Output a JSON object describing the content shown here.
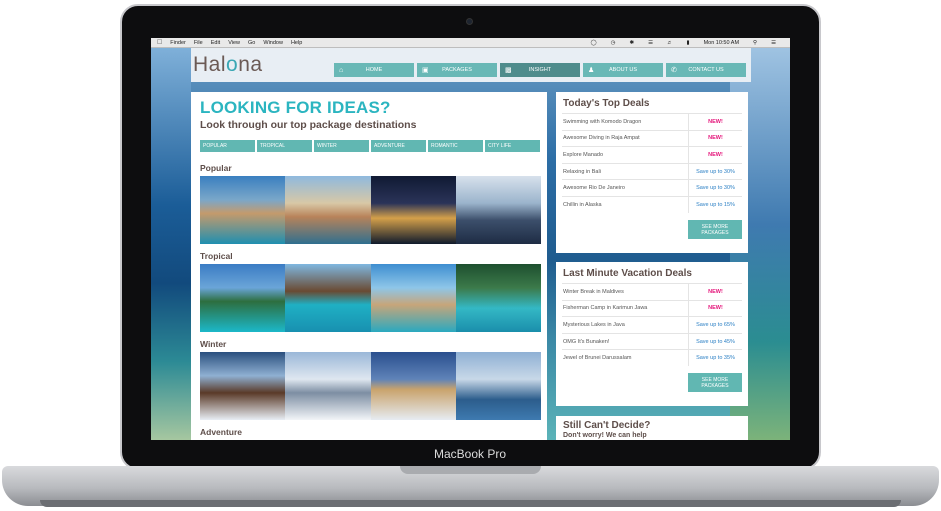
{
  "device": {
    "brand": "MacBook Pro"
  },
  "menubar": {
    "items": [
      "Finder",
      "File",
      "Edit",
      "View",
      "Go",
      "Window",
      "Help"
    ],
    "clock": "Mon 10:50 AM"
  },
  "site": {
    "logo_prefix": "Hal",
    "logo_o": "o",
    "logo_suffix": "na",
    "nav": [
      {
        "label": "HOME",
        "icon": "home-icon"
      },
      {
        "label": "PACKAGES",
        "icon": "gift-icon"
      },
      {
        "label": "INSIGHT",
        "icon": "camera-icon"
      },
      {
        "label": "ABOUT US",
        "icon": "user-icon"
      },
      {
        "label": "CONTACT US",
        "icon": "phone-icon"
      }
    ]
  },
  "main": {
    "heading": "LOOKING FOR IDEAS?",
    "subheading": "Look through our top package destinations",
    "tabs": [
      "POPULAR",
      "TROPICAL",
      "WINTER",
      "ADVENTURE",
      "ROMANTIC",
      "CITY LIFE"
    ],
    "sections": [
      "Popular",
      "Tropical",
      "Winter",
      "Adventure"
    ]
  },
  "top_deals": {
    "title": "Today's Top Deals",
    "rows": [
      {
        "name": "Swimming with Komodo Dragon",
        "tag": "NEW!"
      },
      {
        "name": "Awesome Diving in Raja Ampat",
        "tag": "NEW!"
      },
      {
        "name": "Explore Manado",
        "tag": "NEW!"
      },
      {
        "name": "Relaxing in Bali",
        "tag": "Save up to 30%"
      },
      {
        "name": "Awesome Rio De Janeiro",
        "tag": "Save up to 30%"
      },
      {
        "name": "Chillin in Alaska",
        "tag": "Save up to 15%"
      }
    ],
    "button": "SEE MORE PACKAGES"
  },
  "last_minute": {
    "title": "Last Minute Vacation Deals",
    "rows": [
      {
        "name": "Winter Break in Maldives",
        "tag": "NEW!"
      },
      {
        "name": "Fisherman Camp in Karimun Jawa",
        "tag": "NEW!"
      },
      {
        "name": "Mysterious Lakes in Java",
        "tag": "Save up to 65%"
      },
      {
        "name": "OMG It's Bunaken!",
        "tag": "Save up to 45%"
      },
      {
        "name": "Jewel of Brunei Darussalam",
        "tag": "Save up to 35%"
      }
    ],
    "button": "SEE MORE PACKAGES"
  },
  "decide": {
    "title": "Still Can't Decide?",
    "text": "Don't worry! We can help"
  },
  "colors": {
    "teal": "#61b7b2",
    "heading": "#2bb5c0",
    "new": "#e4157a",
    "save": "#2a7fc4"
  }
}
